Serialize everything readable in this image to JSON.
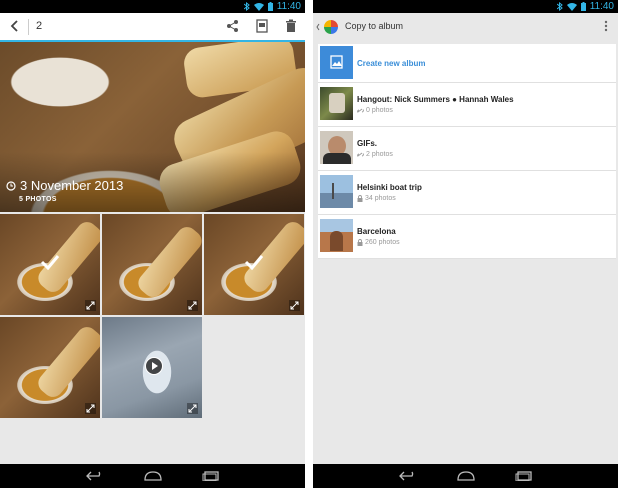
{
  "status_bar": {
    "time": "11:40"
  },
  "left": {
    "action_bar": {
      "selected_count": "2"
    },
    "hero": {
      "date": "3 November 2013",
      "count": "5 PHOTOS"
    }
  },
  "right": {
    "action_bar": {
      "title": "Copy to album"
    },
    "create_album": {
      "label": "Create new album"
    },
    "albums": [
      {
        "name": "Hangout: Nick Summers ● Hannah Wales",
        "count": "0 photos",
        "icon": "link-icon"
      },
      {
        "name": "GIFs.",
        "count": "2 photos",
        "icon": "link-icon"
      },
      {
        "name": "Helsinki boat trip",
        "count": "34 photos",
        "icon": "lock-icon"
      },
      {
        "name": "Barcelona",
        "count": "260 photos",
        "icon": "lock-icon"
      }
    ]
  },
  "colors": {
    "accent": "#33b5e5",
    "create_blue": "#3a8ed8"
  }
}
